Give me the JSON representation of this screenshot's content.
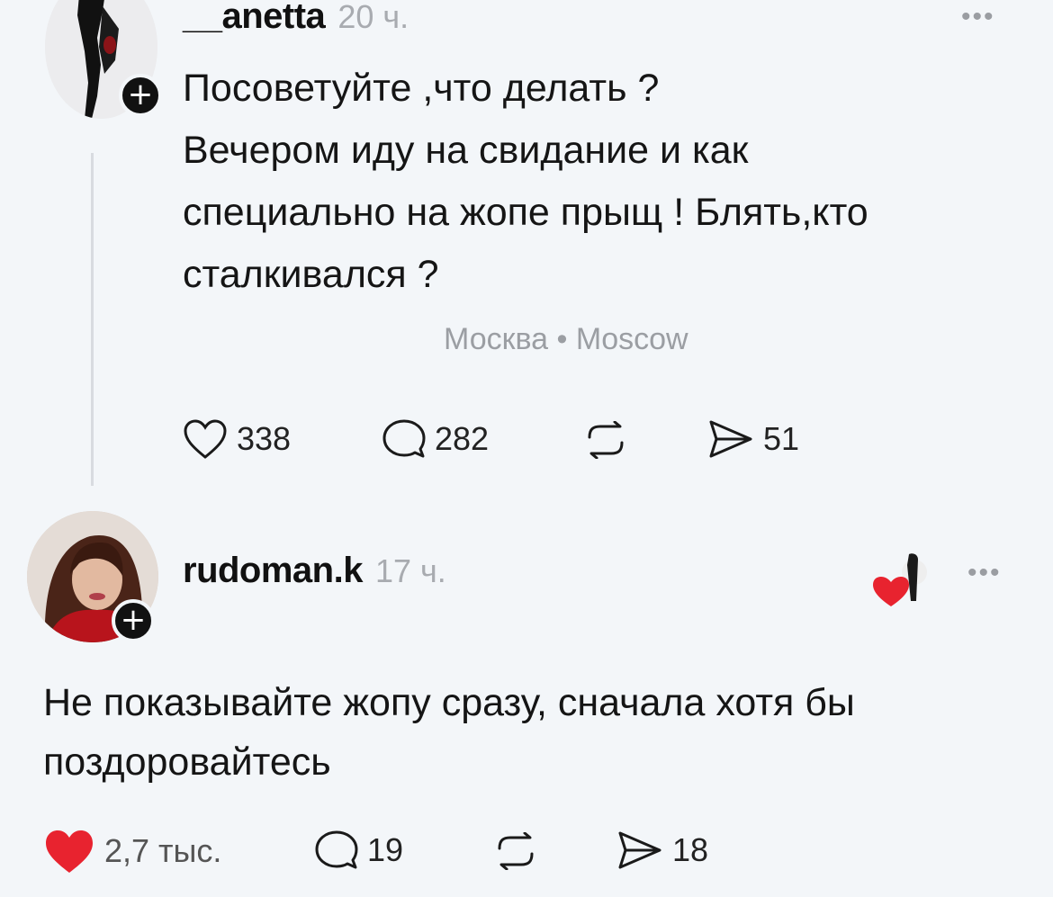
{
  "post1": {
    "username": "__anetta",
    "time": "20 ч.",
    "menu": "•••",
    "lines": [
      "Посоветуйте ,что делать ?",
      "Вечером иду на свидание и как",
      "специально на жопе прыщ ! Блять,кто",
      "сталкивался ?"
    ],
    "location": "Москва • Moscow",
    "likes": "338",
    "comments": "282",
    "shares": "51"
  },
  "post2": {
    "username": "rudoman.k",
    "time": "17 ч.",
    "menu": "•••",
    "lines": [
      "Не показывайте жопу сразу, сначала хотя бы",
      "поздоровайтесь"
    ],
    "likes": "2,7 тыс.",
    "comments": "19",
    "shares": "18"
  },
  "colors": {
    "background": "#f3f6f9",
    "like_red": "#e8232f",
    "muted": "#a8abb0"
  }
}
